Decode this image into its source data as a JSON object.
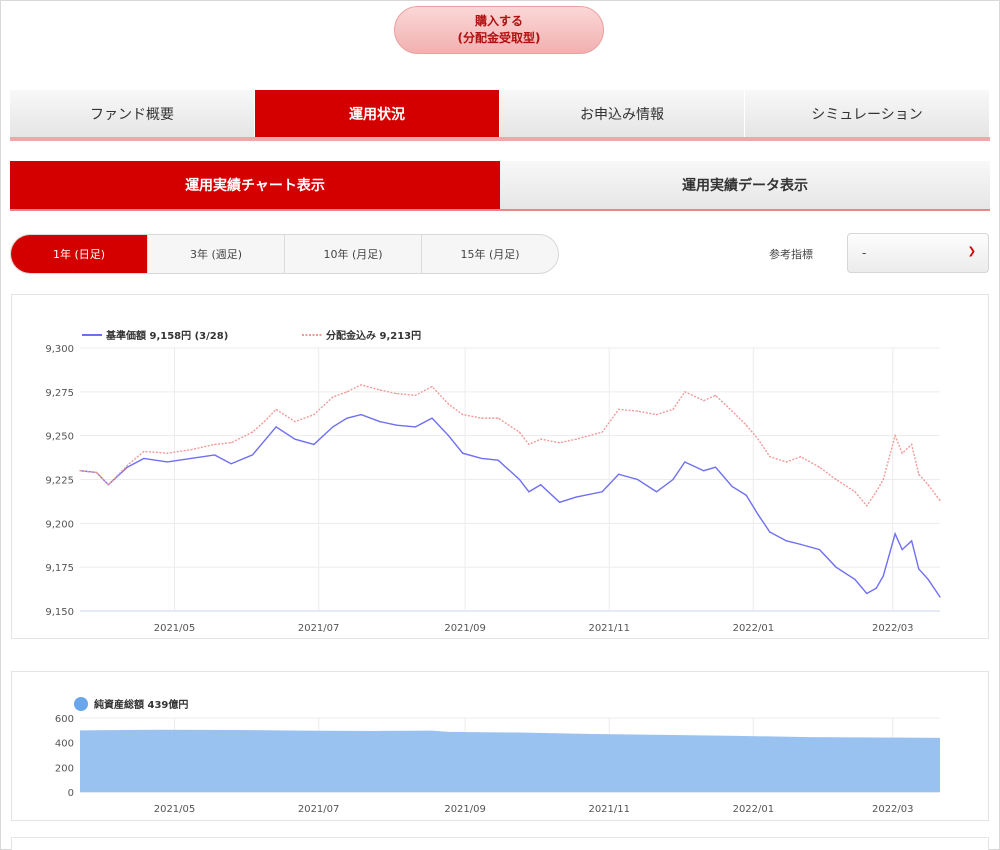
{
  "buy_button": {
    "line1": "購入する",
    "line2": "(分配金受取型)"
  },
  "main_tabs": [
    {
      "label": "ファンド概要",
      "active": false
    },
    {
      "label": "運用状況",
      "active": true
    },
    {
      "label": "お申込み情報",
      "active": false
    },
    {
      "label": "シミュレーション",
      "active": false
    }
  ],
  "sub_tabs": [
    {
      "label": "運用実績チャート表示",
      "active": true
    },
    {
      "label": "運用実績データ表示",
      "active": false
    }
  ],
  "period_buttons": [
    {
      "label": "1年 (日足)",
      "active": true
    },
    {
      "label": "3年 (週足)",
      "active": false
    },
    {
      "label": "10年 (月足)",
      "active": false
    },
    {
      "label": "15年 (月足)",
      "active": false
    }
  ],
  "reference": {
    "label": "参考指標",
    "selected": "-"
  },
  "colors": {
    "accent": "#d40000",
    "nav_line": "#6f6ff2",
    "dist_line": "#f29a9a",
    "assets_fill": "#93bff0"
  },
  "chart_data": [
    {
      "type": "line",
      "legend": [
        "基準価額 9,158円 (3/28)",
        "分配金込み 9,213円"
      ],
      "x_tick_labels": [
        "2021/05",
        "2021/07",
        "2021/09",
        "2021/11",
        "2022/01",
        "2022/03"
      ],
      "y_tick_labels": [
        "9,300",
        "9,275",
        "9,250",
        "9,225",
        "9,200",
        "9,175",
        "9,150"
      ],
      "ylim": [
        9150,
        9300
      ],
      "x_range": [
        "2021/03/29",
        "2022/03/28"
      ],
      "series": [
        {
          "name": "基準価額",
          "color": "#6f6ff2",
          "points": [
            [
              "2021/03/29",
              9230
            ],
            [
              "2021/04/05",
              9229
            ],
            [
              "2021/04/10",
              9222
            ],
            [
              "2021/04/18",
              9232
            ],
            [
              "2021/04/25",
              9237
            ],
            [
              "2021/05/05",
              9235
            ],
            [
              "2021/05/15",
              9237
            ],
            [
              "2021/05/25",
              9239
            ],
            [
              "2021/06/01",
              9234
            ],
            [
              "2021/06/10",
              9239
            ],
            [
              "2021/06/15",
              9247
            ],
            [
              "2021/06/20",
              9255
            ],
            [
              "2021/06/28",
              9248
            ],
            [
              "2021/07/06",
              9245
            ],
            [
              "2021/07/14",
              9255
            ],
            [
              "2021/07/20",
              9260
            ],
            [
              "2021/07/26",
              9262
            ],
            [
              "2021/08/03",
              9258
            ],
            [
              "2021/08/10",
              9256
            ],
            [
              "2021/08/18",
              9255
            ],
            [
              "2021/08/25",
              9260
            ],
            [
              "2021/09/01",
              9250
            ],
            [
              "2021/09/07",
              9240
            ],
            [
              "2021/09/15",
              9237
            ],
            [
              "2021/09/22",
              9236
            ],
            [
              "2021/10/01",
              9225
            ],
            [
              "2021/10/05",
              9218
            ],
            [
              "2021/10/10",
              9222
            ],
            [
              "2021/10/18",
              9212
            ],
            [
              "2021/10/25",
              9215
            ],
            [
              "2021/11/05",
              9218
            ],
            [
              "2021/11/12",
              9228
            ],
            [
              "2021/11/20",
              9225
            ],
            [
              "2021/11/28",
              9218
            ],
            [
              "2021/12/05",
              9225
            ],
            [
              "2021/12/10",
              9235
            ],
            [
              "2021/12/18",
              9230
            ],
            [
              "2021/12/23",
              9232
            ],
            [
              "2021/12/30",
              9221
            ],
            [
              "2022/01/05",
              9216
            ],
            [
              "2022/01/10",
              9205
            ],
            [
              "2022/01/15",
              9195
            ],
            [
              "2022/01/22",
              9190
            ],
            [
              "2022/01/28",
              9188
            ],
            [
              "2022/02/05",
              9185
            ],
            [
              "2022/02/12",
              9175
            ],
            [
              "2022/02/20",
              9168
            ],
            [
              "2022/02/25",
              9160
            ],
            [
              "2022/03/01",
              9163
            ],
            [
              "2022/03/04",
              9170
            ],
            [
              "2022/03/09",
              9194
            ],
            [
              "2022/03/12",
              9185
            ],
            [
              "2022/03/16",
              9190
            ],
            [
              "2022/03/19",
              9174
            ],
            [
              "2022/03/23",
              9168
            ],
            [
              "2022/03/28",
              9158
            ]
          ]
        },
        {
          "name": "分配金込み",
          "color": "#f29a9a",
          "points": [
            [
              "2021/03/29",
              9230
            ],
            [
              "2021/04/05",
              9229
            ],
            [
              "2021/04/10",
              9222
            ],
            [
              "2021/04/18",
              9233
            ],
            [
              "2021/04/25",
              9241
            ],
            [
              "2021/05/05",
              9240
            ],
            [
              "2021/05/15",
              9242
            ],
            [
              "2021/05/25",
              9245
            ],
            [
              "2021/06/01",
              9246
            ],
            [
              "2021/06/10",
              9252
            ],
            [
              "2021/06/15",
              9258
            ],
            [
              "2021/06/20",
              9265
            ],
            [
              "2021/06/28",
              9258
            ],
            [
              "2021/07/06",
              9262
            ],
            [
              "2021/07/14",
              9272
            ],
            [
              "2021/07/20",
              9275
            ],
            [
              "2021/07/26",
              9279
            ],
            [
              "2021/08/03",
              9276
            ],
            [
              "2021/08/10",
              9274
            ],
            [
              "2021/08/18",
              9273
            ],
            [
              "2021/08/25",
              9278
            ],
            [
              "2021/09/01",
              9268
            ],
            [
              "2021/09/07",
              9262
            ],
            [
              "2021/09/15",
              9260
            ],
            [
              "2021/09/22",
              9260
            ],
            [
              "2021/10/01",
              9252
            ],
            [
              "2021/10/05",
              9245
            ],
            [
              "2021/10/10",
              9248
            ],
            [
              "2021/10/18",
              9246
            ],
            [
              "2021/10/25",
              9248
            ],
            [
              "2021/11/05",
              9252
            ],
            [
              "2021/11/12",
              9265
            ],
            [
              "2021/11/20",
              9264
            ],
            [
              "2021/11/28",
              9262
            ],
            [
              "2021/12/05",
              9265
            ],
            [
              "2021/12/10",
              9275
            ],
            [
              "2021/12/18",
              9270
            ],
            [
              "2021/12/23",
              9273
            ],
            [
              "2021/12/30",
              9264
            ],
            [
              "2022/01/05",
              9256
            ],
            [
              "2022/01/10",
              9248
            ],
            [
              "2022/01/15",
              9238
            ],
            [
              "2022/01/22",
              9235
            ],
            [
              "2022/01/28",
              9238
            ],
            [
              "2022/02/05",
              9232
            ],
            [
              "2022/02/12",
              9225
            ],
            [
              "2022/02/20",
              9218
            ],
            [
              "2022/02/25",
              9210
            ],
            [
              "2022/03/01",
              9218
            ],
            [
              "2022/03/04",
              9225
            ],
            [
              "2022/03/09",
              9250
            ],
            [
              "2022/03/12",
              9240
            ],
            [
              "2022/03/16",
              9245
            ],
            [
              "2022/03/19",
              9228
            ],
            [
              "2022/03/23",
              9222
            ],
            [
              "2022/03/28",
              9213
            ]
          ]
        }
      ]
    },
    {
      "type": "area",
      "legend": [
        "純資産総額 439億円"
      ],
      "x_tick_labels": [
        "2021/05",
        "2021/07",
        "2021/09",
        "2021/11",
        "2022/01",
        "2022/03"
      ],
      "y_tick_labels": [
        "600",
        "400",
        "200",
        "0"
      ],
      "ylim": [
        0,
        600
      ],
      "x_range": [
        "2021/03/29",
        "2022/03/28"
      ],
      "series": [
        {
          "name": "純資産総額",
          "color": "#93bff0",
          "points": [
            [
              "2021/03/29",
              500
            ],
            [
              "2021/05/01",
              505
            ],
            [
              "2021/06/01",
              503
            ],
            [
              "2021/07/01",
              498
            ],
            [
              "2021/08/01",
              495
            ],
            [
              "2021/08/25",
              498
            ],
            [
              "2021/09/01",
              487
            ],
            [
              "2021/10/01",
              482
            ],
            [
              "2021/11/01",
              470
            ],
            [
              "2021/12/01",
              463
            ],
            [
              "2022/01/01",
              455
            ],
            [
              "2022/02/01",
              445
            ],
            [
              "2022/03/01",
              442
            ],
            [
              "2022/03/28",
              439
            ]
          ]
        }
      ]
    }
  ]
}
